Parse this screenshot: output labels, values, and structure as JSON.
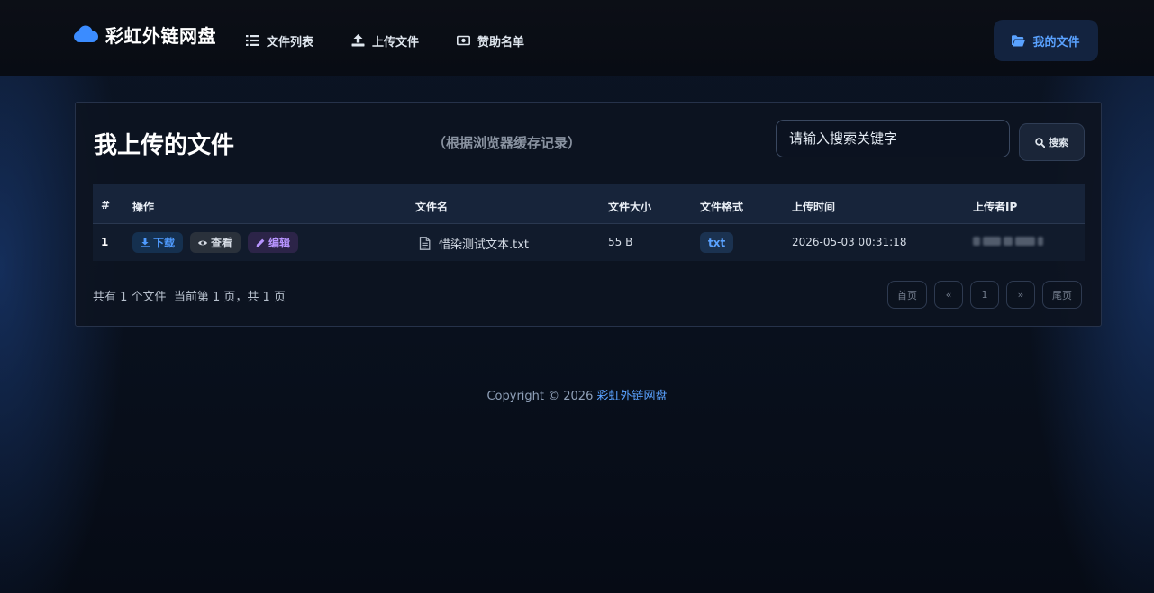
{
  "brand": {
    "name": "彩虹外链网盘",
    "icon": "cloud-icon",
    "color": "#3b8cff"
  },
  "nav": {
    "items": [
      {
        "label": "文件列表",
        "icon": "list-icon"
      },
      {
        "label": "上传文件",
        "icon": "upload-icon"
      },
      {
        "label": "赞助名单",
        "icon": "money-icon"
      }
    ],
    "my_files": {
      "label": "我的文件",
      "icon": "folder-open-icon"
    }
  },
  "panel": {
    "title": "我上传的文件",
    "subtitle": "（根据浏览器缓存记录）",
    "search": {
      "placeholder": "请输入搜索关键字",
      "value": "",
      "button_label": "搜索"
    }
  },
  "table": {
    "headers": [
      "#",
      "操作",
      "文件名",
      "文件大小",
      "文件格式",
      "上传时间",
      "上传者IP"
    ],
    "rows": [
      {
        "index": "1",
        "actions": {
          "download": "下载",
          "view": "查看",
          "edit": "编辑"
        },
        "file_name": "惜染测试文本.txt",
        "file_size": "55 B",
        "file_format": "txt",
        "upload_time": "2026-05-03 00:31:18",
        "uploader_ip": ""
      }
    ]
  },
  "summary": {
    "count_text": "共有 1 个文件",
    "page_text": "当前第 1 页，共 1 页"
  },
  "pagination": {
    "first": "首页",
    "prev": "«",
    "current": "1",
    "next": "»",
    "last": "尾页"
  },
  "footer": {
    "copyright_prefix": "Copyright © 2026",
    "site_name": "彩虹外链网盘"
  },
  "colors": {
    "accent": "#5aa2ff",
    "background": "#0a1220",
    "panel": "#0d1421"
  }
}
